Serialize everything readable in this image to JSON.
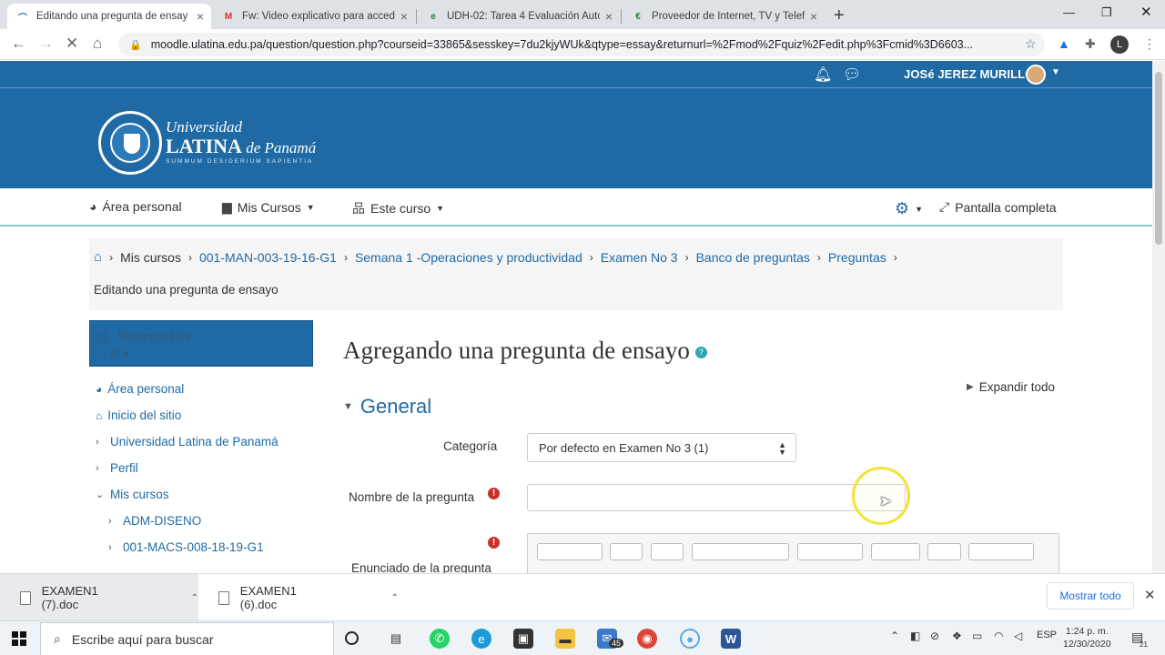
{
  "browser": {
    "tabs": [
      {
        "title": "Editando una pregunta de ensay",
        "icon": "moodle-icon",
        "active": true
      },
      {
        "title": "Fw: Video explicativo para accede",
        "icon": "gmail-icon",
        "active": false
      },
      {
        "title": "UDH-02: Tarea 4 Evaluación Auto",
        "icon": "document-icon",
        "active": false
      },
      {
        "title": "Proveedor de Internet, TV y Telef",
        "icon": "provider-icon",
        "active": false
      }
    ],
    "url": "moodle.ulatina.edu.pa/question/question.php?courseid=33865&sesskey=7du2kjyWUk&qtype=essay&returnurl=%2Fmod%2Fquiz%2Fedit.php%3Fcmid%3D6603...",
    "profile_initial": "L"
  },
  "moodle": {
    "user_name": "JOSé JEREZ MURILLO",
    "logo": {
      "line1": "Universidad",
      "line2": "LATINA",
      "line2b": "de Panamá",
      "motto": "SUMMUM DESIDERIUM SAPIENTIA"
    },
    "nav": {
      "area_personal": "Área personal",
      "mis_cursos": "Mis Cursos",
      "este_curso": "Este curso",
      "pantalla_completa": "Pantalla completa"
    },
    "breadcrumb": [
      "Mis cursos",
      "001-MAN-003-19-16-G1",
      "Semana 1 -Operaciones y productividad",
      "Examen No 3",
      "Banco de preguntas",
      "Preguntas"
    ],
    "breadcrumb_current": "Editando una pregunta de ensayo",
    "navigation_block": {
      "title": "Navegación",
      "items": [
        "Área personal",
        "Inicio del sitio",
        "Universidad Latina de Panamá",
        "Perfil",
        "Mis cursos",
        "ADM-DISENO",
        "001-MACS-008-18-19-G1"
      ]
    },
    "page_title": "Agregando una pregunta de ensayo",
    "expand_all": "Expandir todo",
    "section_general": "General",
    "fields": {
      "category_label": "Categoría",
      "category_value": "Por defecto en Examen No 3 (1)",
      "name_label": "Nombre de la pregunta",
      "statement_label": "Enunciado de la pregunta"
    }
  },
  "downloads": {
    "items": [
      "EXAMEN1 (7).doc",
      "EXAMEN1 (6).doc"
    ],
    "show_all": "Mostrar todo"
  },
  "taskbar": {
    "search_placeholder": "Escribe aquí para buscar",
    "mail_badge": "45",
    "lang": "ESP",
    "time": "1:24 p. m.",
    "date": "12/30/2020",
    "notif_count": "21"
  }
}
